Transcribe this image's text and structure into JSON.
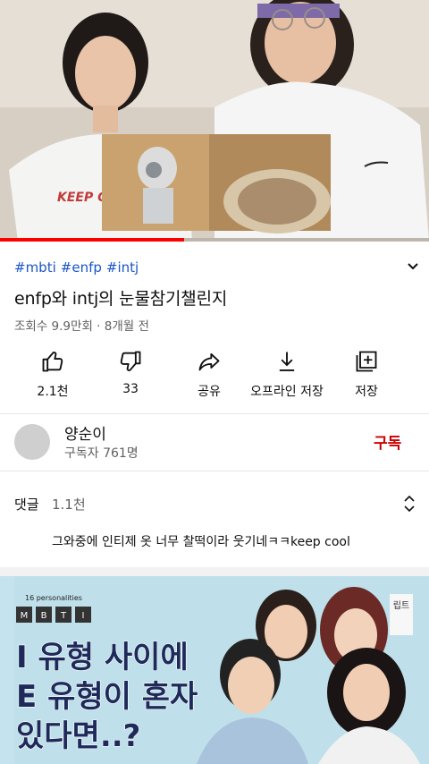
{
  "video": {
    "progress_fraction": 0.43
  },
  "meta": {
    "hashtags": [
      "#mbti",
      "#enfp",
      "#intj"
    ],
    "title": "enfp와 intj의 눈물참기챌린지",
    "stats": "조회수 9.9만회 · 8개월 전"
  },
  "actions": [
    {
      "label": "2.1천",
      "icon": "like-icon"
    },
    {
      "label": "33",
      "icon": "dislike-icon"
    },
    {
      "label": "공유",
      "icon": "share-icon"
    },
    {
      "label": "오프라인 저장",
      "icon": "download-icon"
    },
    {
      "label": "저장",
      "icon": "add-to-playlist-icon"
    }
  ],
  "channel": {
    "name": "양순이",
    "subscribers": "구독자 761명",
    "subscribe_label": "구독"
  },
  "comments": {
    "heading": "댓글",
    "count": "1.1천",
    "top_comment": "그와중에 인티제 옷 너무 찰떡이라 웃기네ㅋㅋkeep cool"
  },
  "next_video": {
    "tag": "16 personalities",
    "mbti_letters": [
      "M",
      "B",
      "T",
      "I"
    ],
    "headline_lines": [
      "I 유형 사이에",
      "E 유형이 혼자",
      "있다면..?"
    ],
    "corner_badge": "립트"
  },
  "colors": {
    "accent_red": "#cc0000",
    "hashtag_blue": "#1a56c8",
    "progress_red": "#ff0000"
  }
}
